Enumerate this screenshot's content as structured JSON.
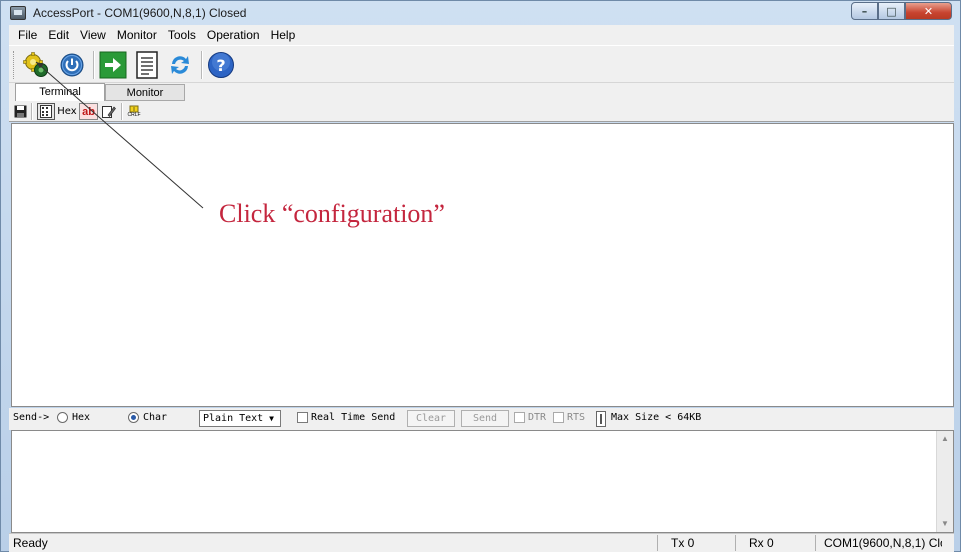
{
  "window": {
    "title": "AccessPort - COM1(9600,N,8,1) Closed"
  },
  "menu": [
    "File",
    "Edit",
    "View",
    "Monitor",
    "Tools",
    "Operation",
    "Help"
  ],
  "toolbar": {
    "icons": [
      "configuration-icon",
      "power-icon",
      "green-arrow-icon",
      "document-icon",
      "refresh-icon",
      "help-icon"
    ]
  },
  "tabs": [
    "Terminal",
    "Monitor"
  ],
  "subtoolbar": {
    "hex_label": "Hex",
    "ab_label": "ab",
    "crlf_label": "CRLF"
  },
  "annotation": {
    "text": "Click “configuration”",
    "color": "#c4263e"
  },
  "sendbar": {
    "send_label": "Send->",
    "hex_label": "Hex",
    "char_label": "Char",
    "mode_value": "Plain Text",
    "realtime_label": "Real Time Send",
    "clear_label": "Clear",
    "send_button_label": "Send",
    "dtr_label": "DTR",
    "rts_label": "RTS",
    "maxsize_label": "Max Size < 64KB"
  },
  "status": {
    "ready": "Ready",
    "tx": "Tx 0",
    "rx": "Rx 0",
    "port": "COM1(9600,N,8,1) Clo"
  }
}
